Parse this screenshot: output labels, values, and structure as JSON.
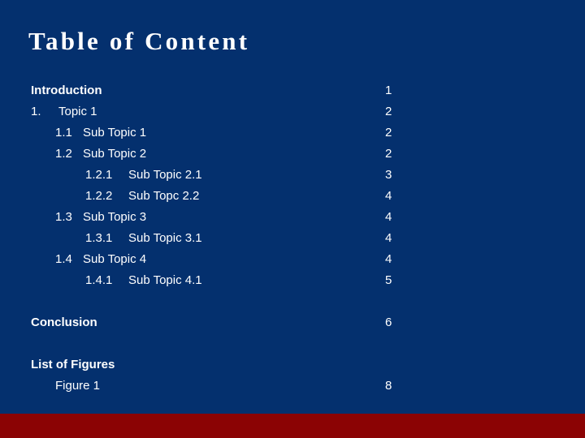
{
  "slide": {
    "title": "Table of Content",
    "background_color": "#04306E",
    "accent_bar_color": "#8B0304",
    "text_color": "#FFFFFF"
  },
  "entries": [
    {
      "number": "",
      "text": "Introduction",
      "page": "1",
      "level": 0,
      "bold": true,
      "spacer_before": false
    },
    {
      "number": "1.",
      "text": "Topic 1",
      "page": "2",
      "level": 1,
      "bold": false,
      "spacer_before": false
    },
    {
      "number": "1.1",
      "text": "Sub Topic 1",
      "page": "2",
      "level": 2,
      "bold": false,
      "spacer_before": false
    },
    {
      "number": "1.2",
      "text": "Sub Topic 2",
      "page": "2",
      "level": 2,
      "bold": false,
      "spacer_before": false
    },
    {
      "number": "1.2.1",
      "text": "Sub Topic 2.1",
      "page": "3",
      "level": 3,
      "bold": false,
      "spacer_before": false
    },
    {
      "number": "1.2.2",
      "text": "Sub Topc 2.2",
      "page": "4",
      "level": 3,
      "bold": false,
      "spacer_before": false
    },
    {
      "number": "1.3",
      "text": "Sub Topic 3",
      "page": "4",
      "level": 2,
      "bold": false,
      "spacer_before": false
    },
    {
      "number": "1.3.1",
      "text": "Sub Topic 3.1",
      "page": "4",
      "level": 3,
      "bold": false,
      "spacer_before": false
    },
    {
      "number": "1.4",
      "text": "Sub Topic 4",
      "page": "4",
      "level": 2,
      "bold": false,
      "spacer_before": false
    },
    {
      "number": "1.4.1",
      "text": "Sub Topic 4.1",
      "page": "5",
      "level": 3,
      "bold": false,
      "spacer_before": false
    },
    {
      "number": "",
      "text": "Conclusion",
      "page": "6",
      "level": 0,
      "bold": true,
      "spacer_before": true
    },
    {
      "number": "",
      "text": "List of Figures",
      "page": "",
      "level": 0,
      "bold": true,
      "spacer_before": true
    },
    {
      "number": "",
      "text": "Figure 1",
      "page": "8",
      "level": 4,
      "bold": false,
      "spacer_before": false
    }
  ]
}
